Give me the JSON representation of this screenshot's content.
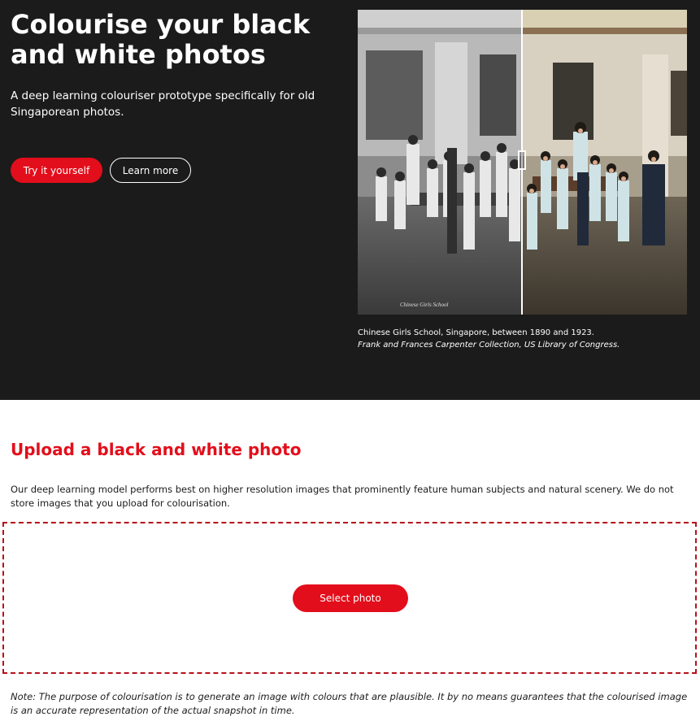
{
  "hero": {
    "title": "Colourise your black and white photos",
    "subtitle": "A deep learning colouriser prototype specifically for old Singaporean photos.",
    "primary_button": "Try it yourself",
    "secondary_button": "Learn more",
    "image_inscription": "Chinese Girls School",
    "caption": "Chinese Girls School, Singapore, between 1890 and 1923.",
    "caption_credit": "Frank and Frances Carpenter Collection, US Library of Congress."
  },
  "upload": {
    "title": "Upload a black and white photo",
    "description": "Our deep learning model performs best on higher resolution images that prominently feature human subjects and natural scenery. We do not store images that you upload for colourisation.",
    "select_button": "Select photo",
    "note": "Note: The purpose of colourisation is to generate an image with colours that are plausible. It by no means guarantees that the colourised image is an accurate representation of the actual snapshot in time."
  },
  "colors": {
    "accent": "#e30e1b",
    "hero_background": "#1b1b1b",
    "dropzone_border": "#b5121b"
  }
}
